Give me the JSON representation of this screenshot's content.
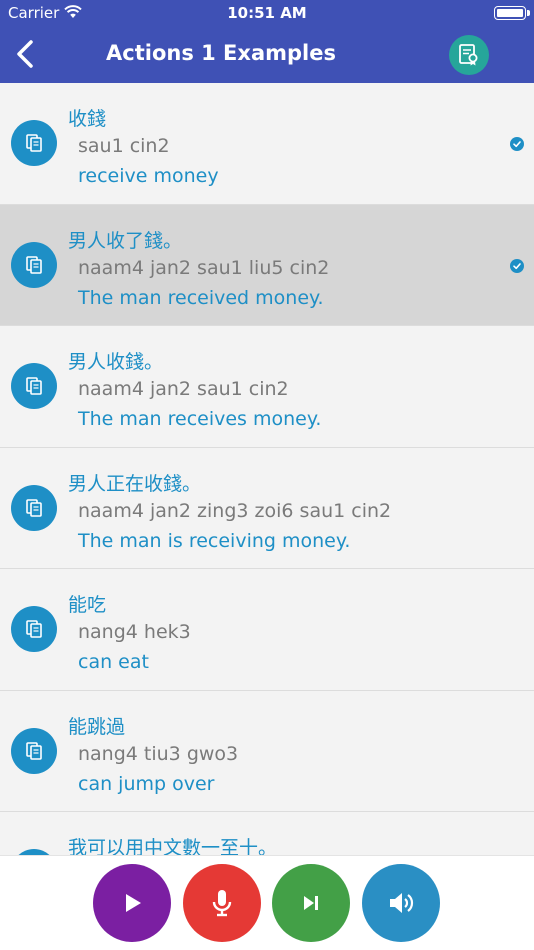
{
  "status_bar": {
    "carrier": "Carrier",
    "time": "10:51 AM"
  },
  "nav": {
    "title": "Actions 1 Examples"
  },
  "examples": [
    {
      "chinese": "收錢",
      "jyutping": "sau1 cin2",
      "english": "receive money",
      "checked": true,
      "selected": false
    },
    {
      "chinese": "男人收了錢。",
      "jyutping": "naam4 jan2 sau1 liu5 cin2",
      "english": "The man received money.",
      "checked": true,
      "selected": true
    },
    {
      "chinese": "男人收錢。",
      "jyutping": "naam4 jan2 sau1 cin2",
      "english": "The man receives money.",
      "checked": false,
      "selected": false
    },
    {
      "chinese": "男人正在收錢。",
      "jyutping": "naam4 jan2 zing3 zoi6 sau1 cin2",
      "english": "The man is receiving money.",
      "checked": false,
      "selected": false
    },
    {
      "chinese": "能吃",
      "jyutping": "nang4 hek3",
      "english": "can eat",
      "checked": false,
      "selected": false
    },
    {
      "chinese": "能跳過",
      "jyutping": "nang4 tiu3 gwo3",
      "english": "can jump over",
      "checked": false,
      "selected": false
    },
    {
      "chinese": "我可以用中文數一至十。",
      "jyutping": "",
      "english": "",
      "checked": false,
      "selected": false
    }
  ],
  "icons": {
    "back": "chevron-left-icon",
    "certificate": "certificate-icon",
    "copy": "copy-icon",
    "check": "check-circle-icon",
    "play": "play-icon",
    "mic": "microphone-icon",
    "next": "skip-next-icon",
    "sound": "speaker-icon"
  },
  "colors": {
    "nav_bg": "#3f51b5",
    "accent": "#1e8fc6",
    "certificate_bg": "#26a69a",
    "play_bg": "#7b1fa2",
    "mic_bg": "#e53935",
    "next_bg": "#43a047",
    "sound_bg": "#2a8fc4",
    "jyutping_text": "#7a7a7a",
    "selected_row_bg": "#d6d6d6"
  }
}
